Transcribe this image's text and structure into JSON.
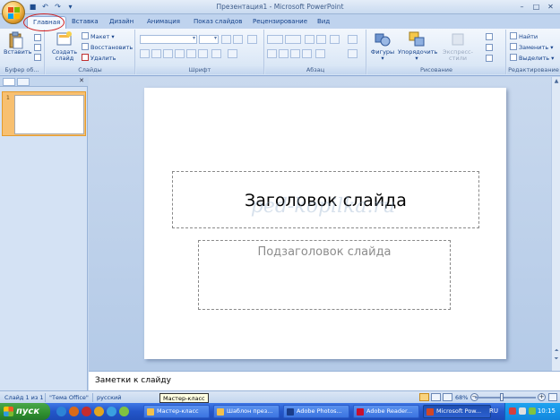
{
  "window": {
    "title": "Презентация1 - Microsoft PowerPoint"
  },
  "ribbon_tabs": [
    {
      "label": "Главная",
      "active": true
    },
    {
      "label": "Вставка"
    },
    {
      "label": "Дизайн"
    },
    {
      "label": "Анимация"
    },
    {
      "label": "Показ слайдов"
    },
    {
      "label": "Рецензирование"
    },
    {
      "label": "Вид"
    }
  ],
  "ribbon": {
    "clipboard": {
      "group_label": "Буфер об...",
      "paste_label": "Вставить"
    },
    "slides": {
      "group_label": "Слайды",
      "new_slide_label": "Создать слайд",
      "layout_label": "Макет",
      "reset_label": "Восстановить",
      "delete_label": "Удалить"
    },
    "font": {
      "group_label": "Шрифт"
    },
    "paragraph": {
      "group_label": "Абзац"
    },
    "drawing": {
      "group_label": "Рисование",
      "shapes_label": "Фигуры",
      "arrange_label": "Упорядочить",
      "quick_styles_label": "Экспресс-стили"
    },
    "editing": {
      "group_label": "Редактирование",
      "find_label": "Найти",
      "replace_label": "Заменить",
      "select_label": "Выделить"
    }
  },
  "slides_panel": {
    "thumb_number": "1"
  },
  "slide": {
    "title_placeholder": "Заголовок слайда",
    "subtitle_placeholder": "Подзаголовок слайда",
    "watermark": "ped-kopilka.ru"
  },
  "notes": {
    "placeholder": "Заметки к слайду"
  },
  "status_bar": {
    "slide_counter": "Слайд 1 из 1",
    "theme": "\"Тема Office\"",
    "language": "русский",
    "tooltip": "Мастер-класс",
    "zoom": "68%"
  },
  "taskbar": {
    "start_label": "пуск",
    "buttons": [
      {
        "label": "Мастер-класс",
        "icon_color": "#f2c14e"
      },
      {
        "label": "Шаблон през...",
        "icon_color": "#f2c14e"
      },
      {
        "label": "Adobe Photos...",
        "icon_color": "#1a3d8a"
      },
      {
        "label": "Adobe Reader...",
        "icon_color": "#c8102e"
      },
      {
        "label": "Microsoft Pow...",
        "icon_color": "#d24726"
      }
    ],
    "lang": "RU",
    "clock": "10:15"
  }
}
